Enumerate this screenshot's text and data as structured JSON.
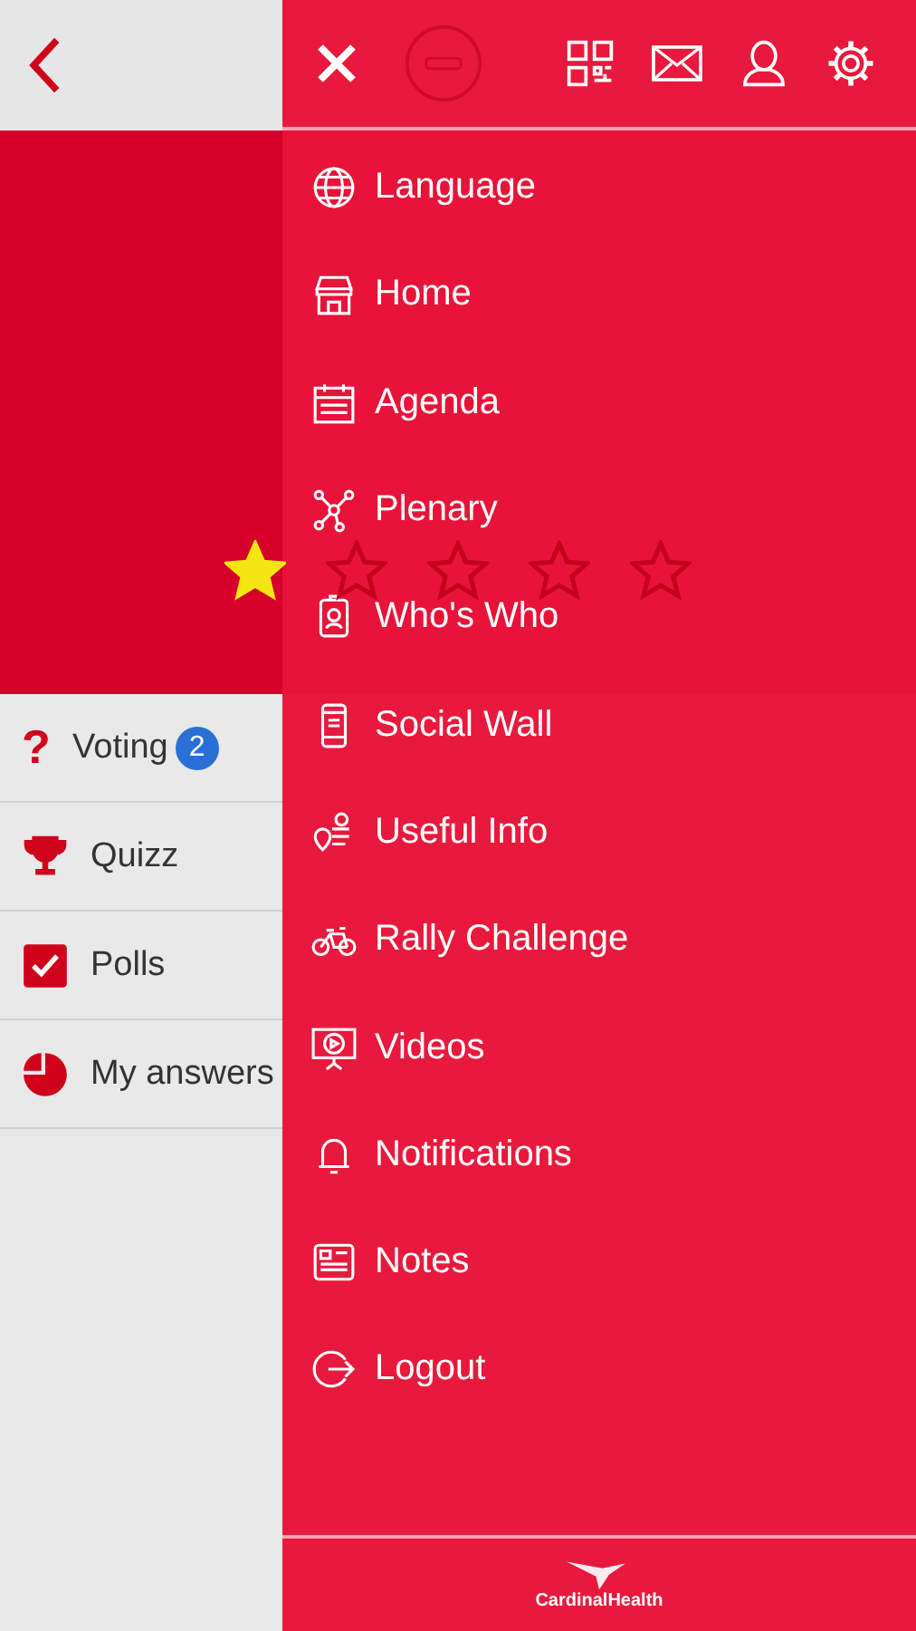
{
  "banner": {
    "stars": 1
  },
  "left_list": [
    {
      "label": "Voting",
      "badge": "2",
      "question_mark": "?"
    },
    {
      "label": "Quizz"
    },
    {
      "label": "Polls"
    },
    {
      "label": "My answers"
    }
  ],
  "menu": [
    {
      "label": "Language"
    },
    {
      "label": "Home"
    },
    {
      "label": "Agenda"
    },
    {
      "label": "Plenary"
    },
    {
      "label": "Who's Who"
    },
    {
      "label": "Social Wall"
    },
    {
      "label": "Useful Info"
    },
    {
      "label": "Rally Challenge"
    },
    {
      "label": "Videos"
    },
    {
      "label": "Notifications"
    },
    {
      "label": "Notes"
    },
    {
      "label": "Logout"
    }
  ],
  "footer": {
    "logo_text": "CardinalHealth"
  }
}
